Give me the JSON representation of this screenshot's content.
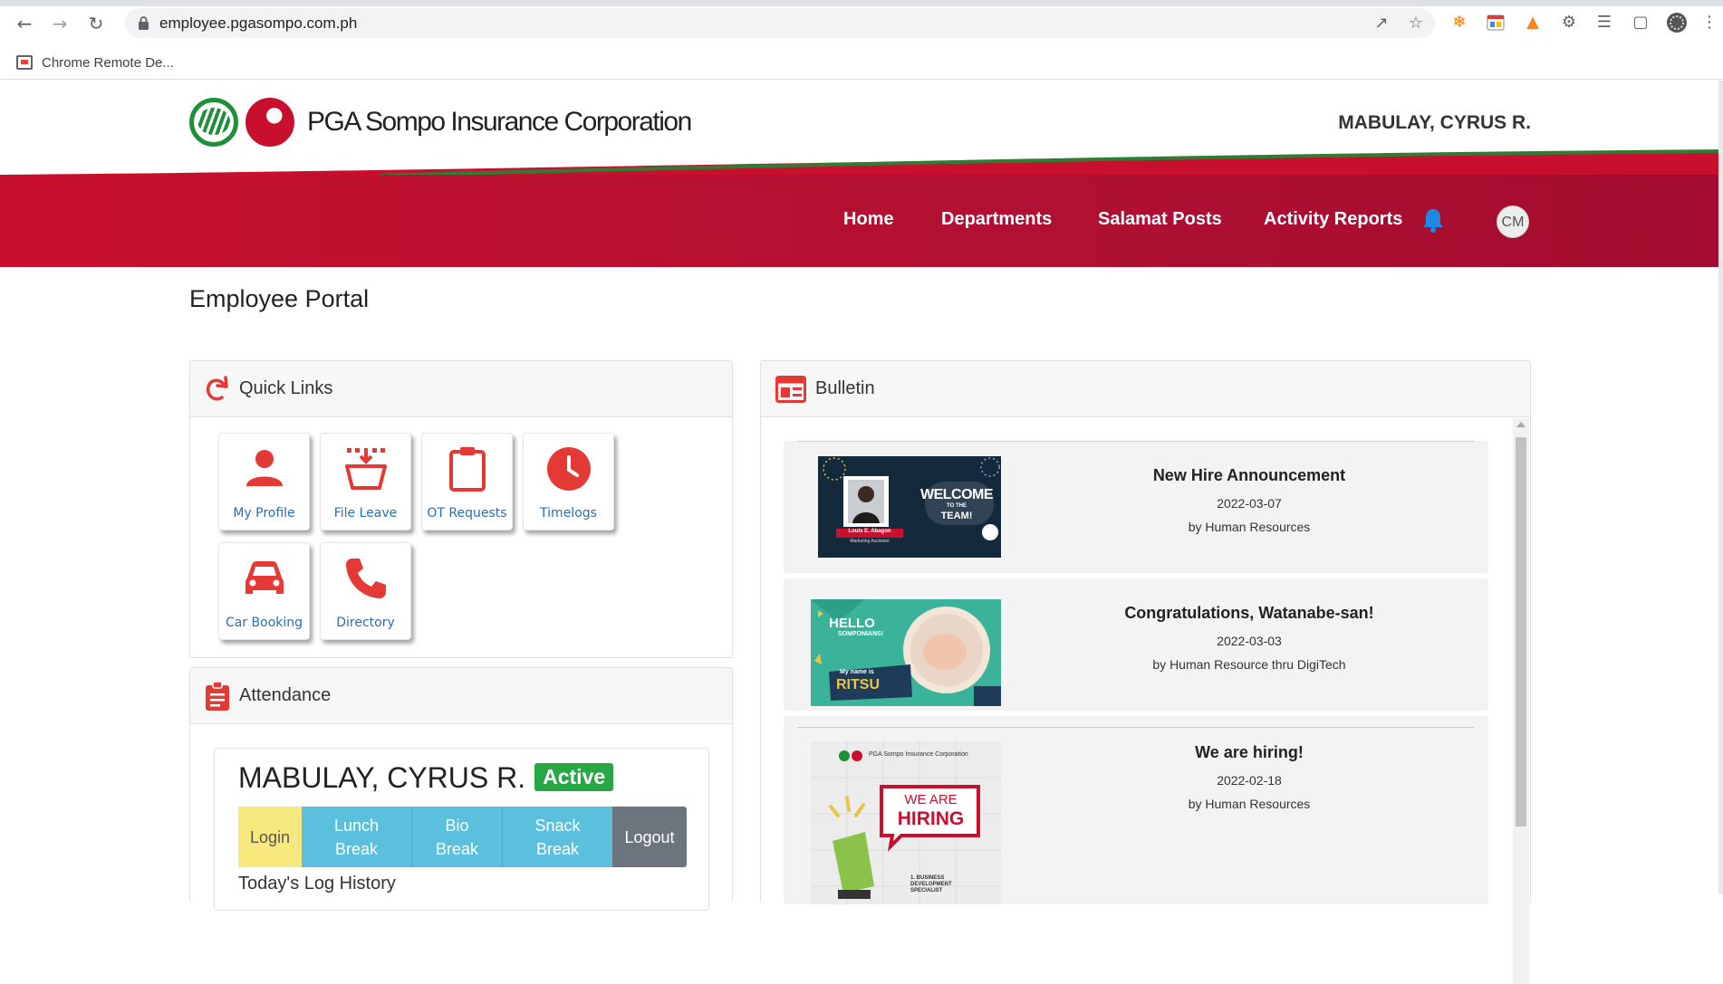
{
  "browser": {
    "url": "employee.pgasompo.com.ph",
    "bookmark": "Chrome Remote De..."
  },
  "header": {
    "company": "PGA Sompo Insurance Corporation",
    "user": "MABULAY, CYRUS R."
  },
  "nav": {
    "items": [
      "Home",
      "Departments",
      "Salamat Posts",
      "Activity Reports"
    ],
    "avatar": "CM"
  },
  "page": {
    "title": "Employee Portal"
  },
  "quick_links": {
    "title": "Quick Links",
    "items": [
      {
        "label": "My Profile",
        "icon": "person-icon"
      },
      {
        "label": "File Leave",
        "icon": "basket-icon"
      },
      {
        "label": "OT Requests",
        "icon": "clipboard-icon"
      },
      {
        "label": "Timelogs",
        "icon": "clock-icon"
      },
      {
        "label": "Car Booking",
        "icon": "car-icon"
      },
      {
        "label": "Directory",
        "icon": "phone-icon"
      }
    ]
  },
  "attendance": {
    "title": "Attendance",
    "name": "MABULAY, CYRUS R.",
    "status": "Active",
    "buttons": {
      "login": "Login",
      "lunch_1": "Lunch",
      "lunch_2": "Break",
      "bio_1": "Bio",
      "bio_2": "Break",
      "snack_1": "Snack",
      "snack_2": "Break",
      "logout": "Logout"
    },
    "history_label": "Today's Log History"
  },
  "bulletin": {
    "title": "Bulletin",
    "posts": [
      {
        "title": "New Hire Announcement",
        "date": "2022-03-07",
        "by": "by Human Resources",
        "img_name": "Louis E. Abagon",
        "img_role": "Marketing Assistant",
        "img_welcome": "WELCOME",
        "img_tothe": "TO THE",
        "img_team": "TEAM!"
      },
      {
        "title": "Congratulations, Watanabe-san!",
        "date": "2022-03-03",
        "by": "by Human Resource thru DigiTech",
        "img_hello": "HELLO",
        "img_somponians": "SOMPONIANS!",
        "img_myname": "My name is",
        "img_ritsu": "RITSU"
      },
      {
        "title": "We are hiring!",
        "date": "2022-02-18",
        "by": "by Human Resources",
        "img_company": "PGA Sompo Insurance Corporation",
        "img_weare": "WE ARE",
        "img_hiring": "HIRING",
        "img_role_1": "1.  BUSINESS",
        "img_role_2": "DEVELOPMENT",
        "img_role_3": "SPECIALIST"
      }
    ]
  },
  "colors": {
    "brand_red": "#c8102e",
    "brand_green": "#1f8f3a",
    "icon_red": "#e53935",
    "link_blue": "#2a6fb0",
    "login_yellow": "#f7e97e",
    "break_blue": "#5bc0de",
    "logout_gray": "#6c757d",
    "active_green": "#28a745"
  }
}
